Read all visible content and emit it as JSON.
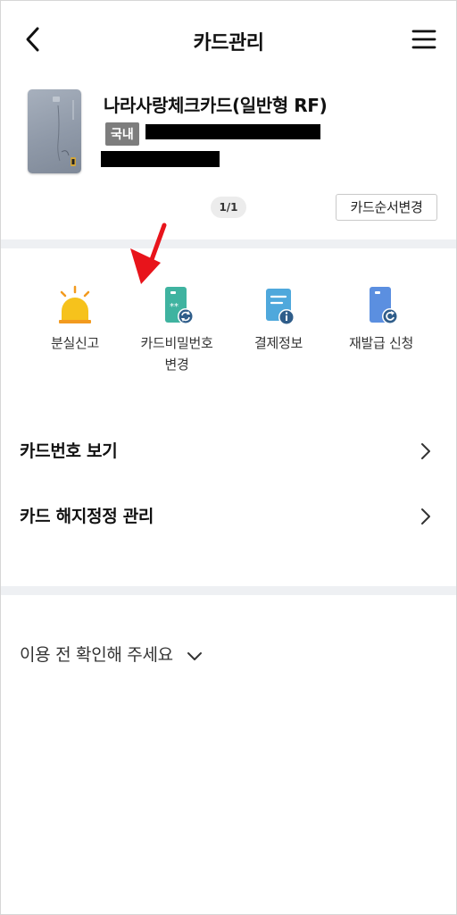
{
  "header": {
    "title": "카드관리",
    "back_icon": "chevron-left-icon",
    "menu_icon": "hamburger-menu-icon"
  },
  "card": {
    "name": "나라사랑체크카드(일반형 RF)",
    "badge": "국내",
    "pager": "1/1",
    "order_button": "카드순서변경"
  },
  "quick_menu": [
    {
      "label": "분실신고",
      "icon": "siren-icon"
    },
    {
      "label": "카드비밀번호",
      "label2": "변경",
      "icon": "card-password-change-icon"
    },
    {
      "label": "결제정보",
      "icon": "payment-info-icon"
    },
    {
      "label": "재발급 신청",
      "icon": "card-reissue-icon"
    }
  ],
  "menu_rows": [
    {
      "label": "카드번호 보기"
    },
    {
      "label": "카드 해지정정 관리"
    }
  ],
  "notice": {
    "label": "이용 전 확인해 주세요"
  },
  "colors": {
    "siren": "#f6c21c",
    "card_password_icon": "#3fb3a0",
    "payment_icon": "#4fa8dc",
    "reissue_icon": "#5b8fe0",
    "annotation_arrow": "#e8141b",
    "section_band": "#eef0f3"
  }
}
